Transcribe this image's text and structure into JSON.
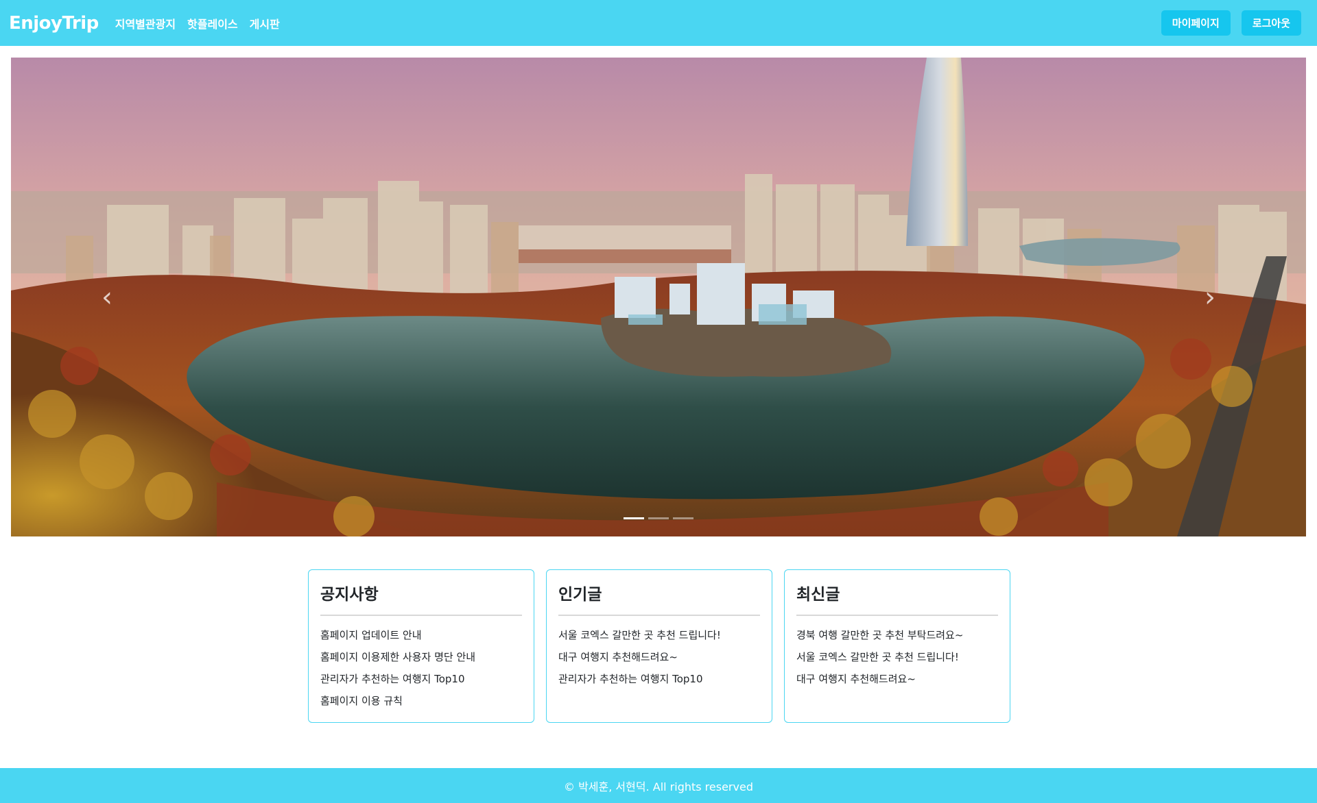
{
  "navbar": {
    "brand": "EnjoyTrip",
    "links": [
      "지역별관광지",
      "핫플레이스",
      "게시판"
    ],
    "buttons": {
      "mypage": "마이페이지",
      "logout": "로그아웃"
    }
  },
  "carousel": {
    "prev_icon": "chevron-left-icon",
    "next_icon": "chevron-right-icon",
    "indicator_count": 3,
    "active_index": 0
  },
  "cards": [
    {
      "title": "공지사항",
      "items": [
        "홈페이지 업데이트 안내",
        "홈페이지 이용제한 사용자 명단 안내",
        "관리자가 추천하는 여행지 Top10",
        "홈페이지 이용 규칙"
      ]
    },
    {
      "title": "인기글",
      "items": [
        "서울 코엑스 갈만한 곳 추천 드립니다!",
        "대구 여행지 추천해드려요~",
        "관리자가 추천하는 여행지 Top10"
      ]
    },
    {
      "title": "최신글",
      "items": [
        "경북 여행 갈만한 곳 추천 부탁드려요~",
        "서울 코엑스 갈만한 곳 추천 드립니다!",
        "대구 여행지 추천해드려요~"
      ]
    }
  ],
  "footer": {
    "text": "© 박세훈, 서현덕. All rights reserved"
  },
  "colors": {
    "accent": "#4ad6f2",
    "button": "#16c6ee"
  }
}
